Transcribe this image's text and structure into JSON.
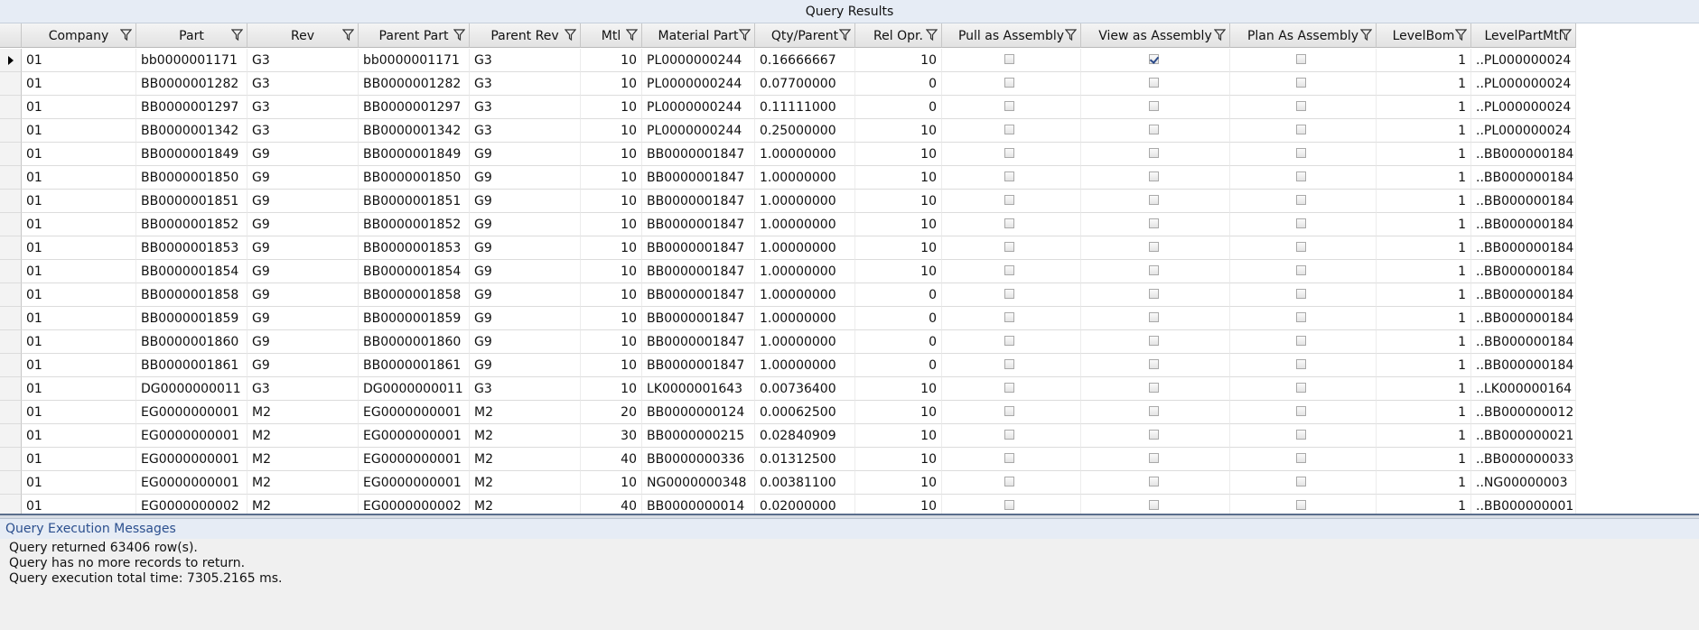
{
  "results_panel": {
    "title": "Query Results"
  },
  "columns": [
    {
      "key": "company",
      "label": "Company"
    },
    {
      "key": "part",
      "label": "Part"
    },
    {
      "key": "rev",
      "label": "Rev"
    },
    {
      "key": "parent_part",
      "label": "Parent Part"
    },
    {
      "key": "parent_rev",
      "label": "Parent Rev"
    },
    {
      "key": "mtl",
      "label": "Mtl"
    },
    {
      "key": "material_part",
      "label": "Material Part"
    },
    {
      "key": "qty_parent",
      "label": "Qty/Parent"
    },
    {
      "key": "rel_opr",
      "label": "Rel Opr."
    },
    {
      "key": "pull_as_assembly",
      "label": "Pull as Assembly"
    },
    {
      "key": "view_as_assembly",
      "label": "View as Assembly"
    },
    {
      "key": "plan_as_assembly",
      "label": "Plan As Assembly"
    },
    {
      "key": "level_bom",
      "label": "LevelBom"
    },
    {
      "key": "level_part_mtl",
      "label": "LevelPartMtl"
    }
  ],
  "rows": [
    {
      "current": true,
      "company": "01",
      "part": "bb0000001171",
      "rev": "G3",
      "parent_part": "bb0000001171",
      "parent_rev": "G3",
      "mtl": "10",
      "material_part": "PL0000000244",
      "qty_parent": "0.16666667",
      "rel_opr": "10",
      "pull_as_assembly": false,
      "view_as_assembly": true,
      "plan_as_assembly": false,
      "level_bom": "1",
      "level_part_mtl": "..PL000000024"
    },
    {
      "company": "01",
      "part": "BB0000001282",
      "rev": "G3",
      "parent_part": "BB0000001282",
      "parent_rev": "G3",
      "mtl": "10",
      "material_part": "PL0000000244",
      "qty_parent": "0.07700000",
      "rel_opr": "0",
      "pull_as_assembly": false,
      "view_as_assembly": false,
      "plan_as_assembly": false,
      "level_bom": "1",
      "level_part_mtl": "..PL000000024"
    },
    {
      "company": "01",
      "part": "BB0000001297",
      "rev": "G3",
      "parent_part": "BB0000001297",
      "parent_rev": "G3",
      "mtl": "10",
      "material_part": "PL0000000244",
      "qty_parent": "0.11111000",
      "rel_opr": "0",
      "pull_as_assembly": false,
      "view_as_assembly": false,
      "plan_as_assembly": false,
      "level_bom": "1",
      "level_part_mtl": "..PL000000024"
    },
    {
      "company": "01",
      "part": "BB0000001342",
      "rev": "G3",
      "parent_part": "BB0000001342",
      "parent_rev": "G3",
      "mtl": "10",
      "material_part": "PL0000000244",
      "qty_parent": "0.25000000",
      "rel_opr": "10",
      "pull_as_assembly": false,
      "view_as_assembly": false,
      "plan_as_assembly": false,
      "level_bom": "1",
      "level_part_mtl": "..PL000000024"
    },
    {
      "company": "01",
      "part": "BB0000001849",
      "rev": "G9",
      "parent_part": "BB0000001849",
      "parent_rev": "G9",
      "mtl": "10",
      "material_part": "BB0000001847",
      "qty_parent": "1.00000000",
      "rel_opr": "10",
      "pull_as_assembly": false,
      "view_as_assembly": false,
      "plan_as_assembly": false,
      "level_bom": "1",
      "level_part_mtl": "..BB000000184"
    },
    {
      "company": "01",
      "part": "BB0000001850",
      "rev": "G9",
      "parent_part": "BB0000001850",
      "parent_rev": "G9",
      "mtl": "10",
      "material_part": "BB0000001847",
      "qty_parent": "1.00000000",
      "rel_opr": "10",
      "pull_as_assembly": false,
      "view_as_assembly": false,
      "plan_as_assembly": false,
      "level_bom": "1",
      "level_part_mtl": "..BB000000184"
    },
    {
      "company": "01",
      "part": "BB0000001851",
      "rev": "G9",
      "parent_part": "BB0000001851",
      "parent_rev": "G9",
      "mtl": "10",
      "material_part": "BB0000001847",
      "qty_parent": "1.00000000",
      "rel_opr": "10",
      "pull_as_assembly": false,
      "view_as_assembly": false,
      "plan_as_assembly": false,
      "level_bom": "1",
      "level_part_mtl": "..BB000000184"
    },
    {
      "company": "01",
      "part": "BB0000001852",
      "rev": "G9",
      "parent_part": "BB0000001852",
      "parent_rev": "G9",
      "mtl": "10",
      "material_part": "BB0000001847",
      "qty_parent": "1.00000000",
      "rel_opr": "10",
      "pull_as_assembly": false,
      "view_as_assembly": false,
      "plan_as_assembly": false,
      "level_bom": "1",
      "level_part_mtl": "..BB000000184"
    },
    {
      "company": "01",
      "part": "BB0000001853",
      "rev": "G9",
      "parent_part": "BB0000001853",
      "parent_rev": "G9",
      "mtl": "10",
      "material_part": "BB0000001847",
      "qty_parent": "1.00000000",
      "rel_opr": "10",
      "pull_as_assembly": false,
      "view_as_assembly": false,
      "plan_as_assembly": false,
      "level_bom": "1",
      "level_part_mtl": "..BB000000184"
    },
    {
      "company": "01",
      "part": "BB0000001854",
      "rev": "G9",
      "parent_part": "BB0000001854",
      "parent_rev": "G9",
      "mtl": "10",
      "material_part": "BB0000001847",
      "qty_parent": "1.00000000",
      "rel_opr": "10",
      "pull_as_assembly": false,
      "view_as_assembly": false,
      "plan_as_assembly": false,
      "level_bom": "1",
      "level_part_mtl": "..BB000000184"
    },
    {
      "company": "01",
      "part": "BB0000001858",
      "rev": "G9",
      "parent_part": "BB0000001858",
      "parent_rev": "G9",
      "mtl": "10",
      "material_part": "BB0000001847",
      "qty_parent": "1.00000000",
      "rel_opr": "0",
      "pull_as_assembly": false,
      "view_as_assembly": false,
      "plan_as_assembly": false,
      "level_bom": "1",
      "level_part_mtl": "..BB000000184"
    },
    {
      "company": "01",
      "part": "BB0000001859",
      "rev": "G9",
      "parent_part": "BB0000001859",
      "parent_rev": "G9",
      "mtl": "10",
      "material_part": "BB0000001847",
      "qty_parent": "1.00000000",
      "rel_opr": "0",
      "pull_as_assembly": false,
      "view_as_assembly": false,
      "plan_as_assembly": false,
      "level_bom": "1",
      "level_part_mtl": "..BB000000184"
    },
    {
      "company": "01",
      "part": "BB0000001860",
      "rev": "G9",
      "parent_part": "BB0000001860",
      "parent_rev": "G9",
      "mtl": "10",
      "material_part": "BB0000001847",
      "qty_parent": "1.00000000",
      "rel_opr": "0",
      "pull_as_assembly": false,
      "view_as_assembly": false,
      "plan_as_assembly": false,
      "level_bom": "1",
      "level_part_mtl": "..BB000000184"
    },
    {
      "company": "01",
      "part": "BB0000001861",
      "rev": "G9",
      "parent_part": "BB0000001861",
      "parent_rev": "G9",
      "mtl": "10",
      "material_part": "BB0000001847",
      "qty_parent": "1.00000000",
      "rel_opr": "0",
      "pull_as_assembly": false,
      "view_as_assembly": false,
      "plan_as_assembly": false,
      "level_bom": "1",
      "level_part_mtl": "..BB000000184"
    },
    {
      "company": "01",
      "part": "DG0000000011",
      "rev": "G3",
      "parent_part": "DG0000000011",
      "parent_rev": "G3",
      "mtl": "10",
      "material_part": "LK0000001643",
      "qty_parent": "0.00736400",
      "rel_opr": "10",
      "pull_as_assembly": false,
      "view_as_assembly": false,
      "plan_as_assembly": false,
      "level_bom": "1",
      "level_part_mtl": "..LK000000164"
    },
    {
      "company": "01",
      "part": "EG0000000001",
      "rev": "M2",
      "parent_part": "EG0000000001",
      "parent_rev": "M2",
      "mtl": "20",
      "material_part": "BB0000000124",
      "qty_parent": "0.00062500",
      "rel_opr": "10",
      "pull_as_assembly": false,
      "view_as_assembly": false,
      "plan_as_assembly": false,
      "level_bom": "1",
      "level_part_mtl": "..BB000000012"
    },
    {
      "company": "01",
      "part": "EG0000000001",
      "rev": "M2",
      "parent_part": "EG0000000001",
      "parent_rev": "M2",
      "mtl": "30",
      "material_part": "BB0000000215",
      "qty_parent": "0.02840909",
      "rel_opr": "10",
      "pull_as_assembly": false,
      "view_as_assembly": false,
      "plan_as_assembly": false,
      "level_bom": "1",
      "level_part_mtl": "..BB000000021"
    },
    {
      "company": "01",
      "part": "EG0000000001",
      "rev": "M2",
      "parent_part": "EG0000000001",
      "parent_rev": "M2",
      "mtl": "40",
      "material_part": "BB0000000336",
      "qty_parent": "0.01312500",
      "rel_opr": "10",
      "pull_as_assembly": false,
      "view_as_assembly": false,
      "plan_as_assembly": false,
      "level_bom": "1",
      "level_part_mtl": "..BB000000033"
    },
    {
      "company": "01",
      "part": "EG0000000001",
      "rev": "M2",
      "parent_part": "EG0000000001",
      "parent_rev": "M2",
      "mtl": "10",
      "material_part": "NG0000000348",
      "qty_parent": "0.00381100",
      "rel_opr": "10",
      "pull_as_assembly": false,
      "view_as_assembly": false,
      "plan_as_assembly": false,
      "level_bom": "1",
      "level_part_mtl": "..NG00000003"
    },
    {
      "company": "01",
      "part": "EG0000000002",
      "rev": "M2",
      "parent_part": "EG0000000002",
      "parent_rev": "M2",
      "mtl": "40",
      "material_part": "BB0000000014",
      "qty_parent": "0.02000000",
      "rel_opr": "10",
      "pull_as_assembly": false,
      "view_as_assembly": false,
      "plan_as_assembly": false,
      "level_bom": "1",
      "level_part_mtl": "..BB000000001"
    }
  ],
  "messages_panel": {
    "title": "Query Execution Messages",
    "lines": [
      "Query returned 63406 row(s).",
      "Query has no more records to return.",
      "Query execution total time: 7305.2165 ms."
    ]
  }
}
